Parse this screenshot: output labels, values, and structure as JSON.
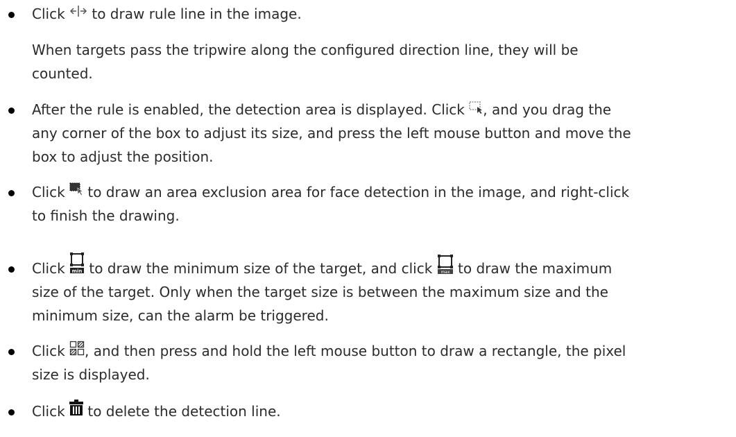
{
  "items": [
    {
      "lines": [
        {
          "before": "Click ",
          "icon": "rule-line-icon",
          "after": " to draw rule line in the image."
        }
      ],
      "note": [
        "When targets pass the tripwire along the configured direction line, they will be",
        "counted."
      ]
    },
    {
      "lines": [
        {
          "before": "After the rule is enabled, the detection area is displayed. Click ",
          "icon": "detection-area-icon",
          "after": ", and you drag the"
        },
        {
          "text": "any corner of the box to adjust its size, and press the left mouse button and move the"
        },
        {
          "text": "box to adjust the position."
        }
      ]
    },
    {
      "lines": [
        {
          "before": "Click ",
          "icon": "exclusion-area-icon",
          "after": " to draw an area exclusion area for face detection in the image, and right-click"
        },
        {
          "text": "to finish the drawing."
        }
      ]
    },
    {
      "lines": [
        {
          "before": "Click ",
          "icon": "min-size-icon",
          "icon_label": "min",
          "middle": " to draw the minimum size of the target, and click ",
          "icon2": "max-size-icon",
          "icon2_label": "max",
          "after": " to draw the maximum"
        },
        {
          "text": "size of the target. Only when the target size is between the maximum size and the"
        },
        {
          "text": "minimum size, can the alarm be triggered."
        }
      ]
    },
    {
      "lines": [
        {
          "before": "Click ",
          "icon": "pixel-counter-icon",
          "after": ", and then press and hold the left mouse button to draw a rectangle, the pixel"
        },
        {
          "text": "size is displayed."
        }
      ]
    },
    {
      "lines": [
        {
          "before": "Click ",
          "icon": "delete-icon",
          "after": " to delete the detection line."
        }
      ]
    }
  ]
}
